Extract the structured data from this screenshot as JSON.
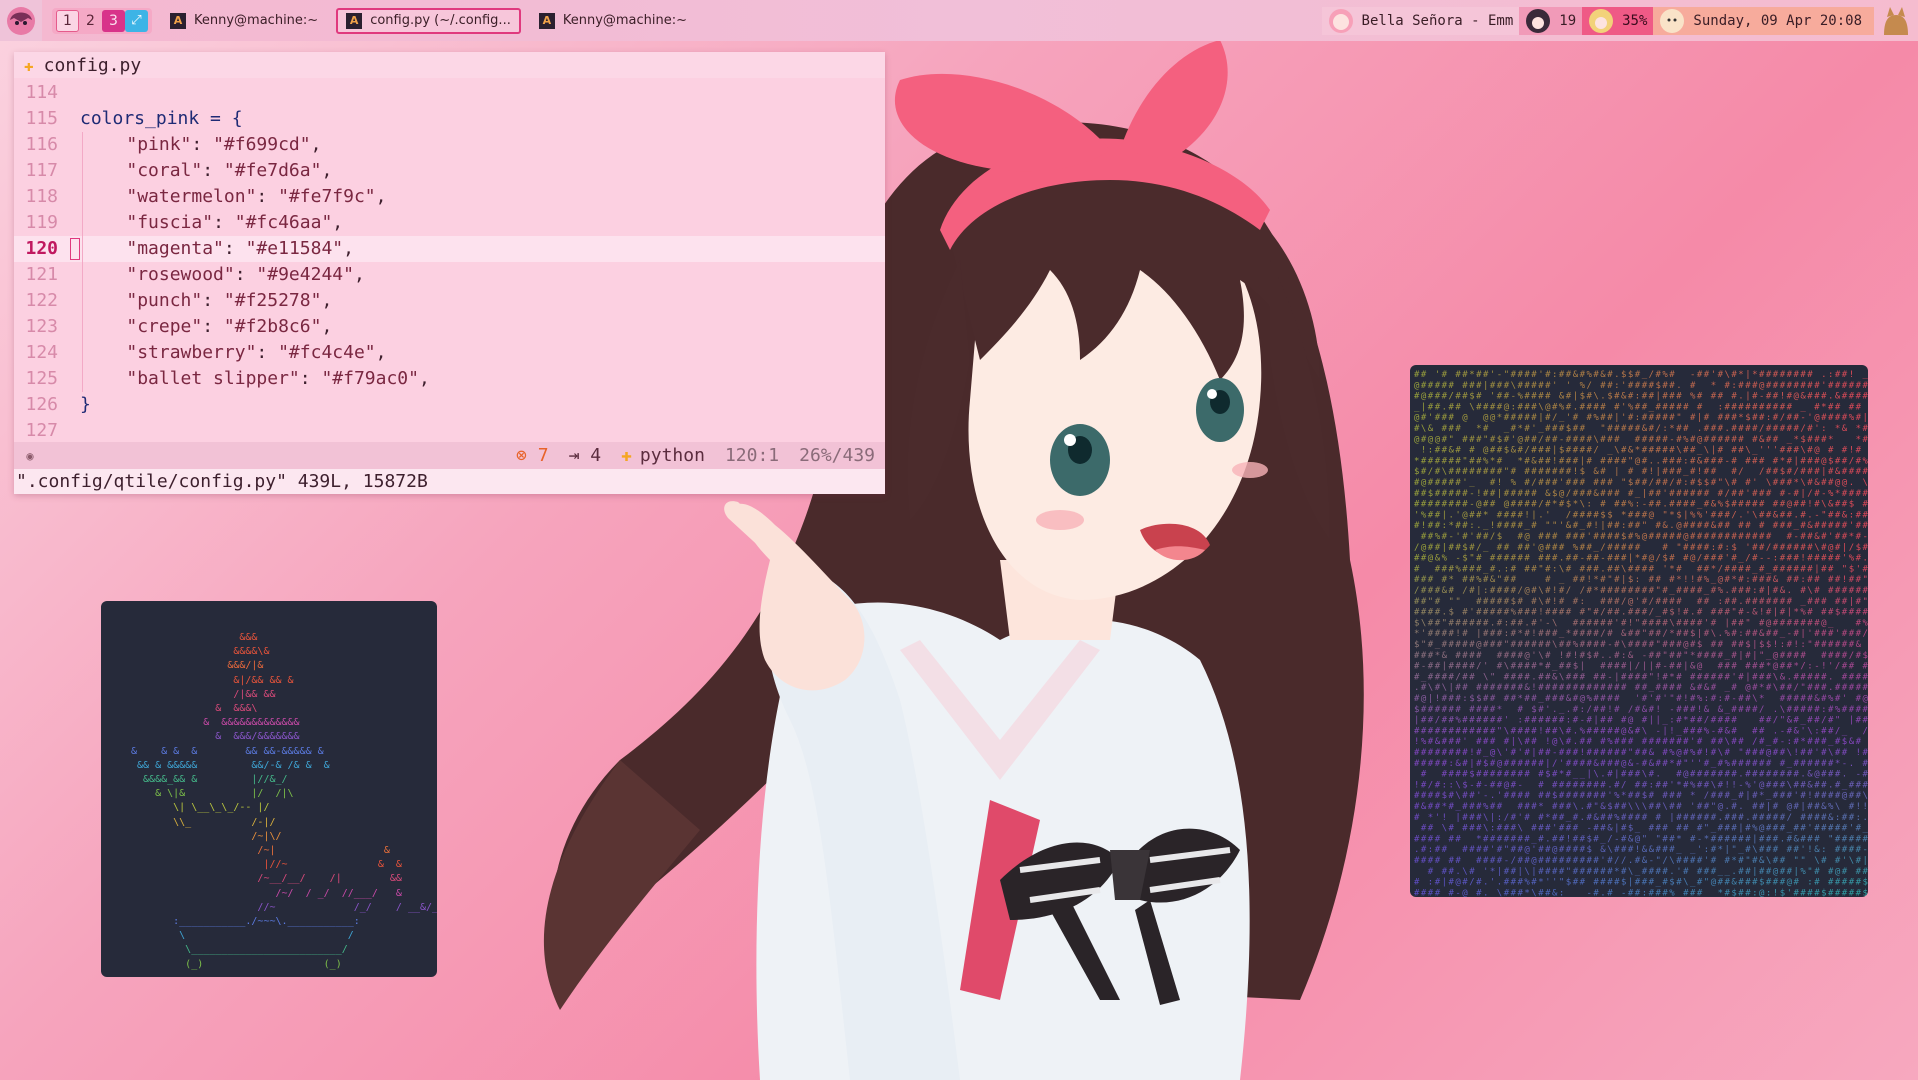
{
  "topbar": {
    "groups": [
      "1",
      "2",
      "3",
      "⤢"
    ],
    "tasks": [
      {
        "label": "Kenny@machine:~",
        "focused": false
      },
      {
        "label": "config.py (~/.config...",
        "focused": true
      },
      {
        "label": "Kenny@machine:~",
        "focused": false
      }
    ],
    "music": "Bella Señora - Emm",
    "updates": "19",
    "battery": "35%",
    "clock": "Sunday, 09 Apr 20:08"
  },
  "editor": {
    "tab_title": "config.py",
    "lines": [
      {
        "num": "114",
        "text": ""
      },
      {
        "num": "115",
        "text": "colors_pink = {"
      },
      {
        "num": "116",
        "key": "\"pink\"",
        "value": "\"#f699cd\""
      },
      {
        "num": "117",
        "key": "\"coral\"",
        "value": "\"#fe7d6a\""
      },
      {
        "num": "118",
        "key": "\"watermelon\"",
        "value": "\"#fe7f9c\""
      },
      {
        "num": "119",
        "key": "\"fuscia\"",
        "value": "\"#fc46aa\""
      },
      {
        "num": "120",
        "key": "\"magenta\"",
        "value": "\"#e11584\""
      },
      {
        "num": "121",
        "key": "\"rosewood\"",
        "value": "\"#9e4244\""
      },
      {
        "num": "122",
        "key": "\"punch\"",
        "value": "\"#f25278\""
      },
      {
        "num": "123",
        "key": "\"crepe\"",
        "value": "\"#f2b8c6\""
      },
      {
        "num": "124",
        "key": "\"strawberry\"",
        "value": "\"#fc4c4e\""
      },
      {
        "num": "125",
        "key": "\"ballet slipper\"",
        "value": "\"#f79ac0\""
      },
      {
        "num": "126",
        "text": "}"
      },
      {
        "num": "127",
        "text": ""
      }
    ],
    "status": {
      "errors": "7",
      "indent": "4",
      "language": "python",
      "cursor": "120:1",
      "progress": "26%/439"
    },
    "cmdline": "\".config/qtile/config.py\" 439L, 15872B"
  },
  "ascii_boat": [
    {
      "t": "                  &&&",
      "c": "#e8543b"
    },
    {
      "t": "                 &&&&\\&",
      "c": "#e8543b"
    },
    {
      "t": "                &&&/|&",
      "c": "#ea6a3c"
    },
    {
      "t": "                 &|/&& && &",
      "c": "#e8543b"
    },
    {
      "t": "                 /|&& &&",
      "c": "#d84a7a"
    },
    {
      "t": "              &  &&&\\",
      "c": "#d84a7a"
    },
    {
      "t": "            &  &&&&&&&&&&&&&",
      "c": "#c94aa8"
    },
    {
      "t": "              &  &&&/&&&&&&&",
      "c": "#8a55c9"
    },
    {
      "t": "&    & &  &        && &&-&&&&& &",
      "c": "#5b7ae0"
    },
    {
      "t": " && & &&&&&         &&/-& /& &  &",
      "c": "#3fa6d6"
    },
    {
      "t": "  &&&&_&& &         |//&_/",
      "c": "#45b98a"
    },
    {
      "t": "    & \\|&           |/  /|\\",
      "c": "#7dc04a"
    },
    {
      "t": "       \\| \\__\\_\\_/-- |/",
      "c": "#b9c53e"
    },
    {
      "t": "       \\\\_          /-|/",
      "c": "#d9b13d"
    },
    {
      "t": "                    /~|\\/",
      "c": "#e8903b"
    },
    {
      "t": "                     /~|                  &",
      "c": "#e8703b"
    },
    {
      "t": "                      |//~               &  &",
      "c": "#e8543b"
    },
    {
      "t": "                     /~__/__/    /|        &&",
      "c": "#d84a7a"
    },
    {
      "t": "                        /~/  / _/  //___/   &",
      "c": "#c94aa8"
    },
    {
      "t": "                     //~             /_/    / __&/_/_&",
      "c": "#8a55c9"
    },
    {
      "t": "       :___________./~~~\\.___________:",
      "c": "#5b7ae0"
    },
    {
      "t": "        \\                           /",
      "c": "#3fa6d6"
    },
    {
      "t": "         \\_________________________/",
      "c": "#45b98a"
    },
    {
      "t": "         (_)                    (_)",
      "c": "#7dc04a"
    }
  ]
}
